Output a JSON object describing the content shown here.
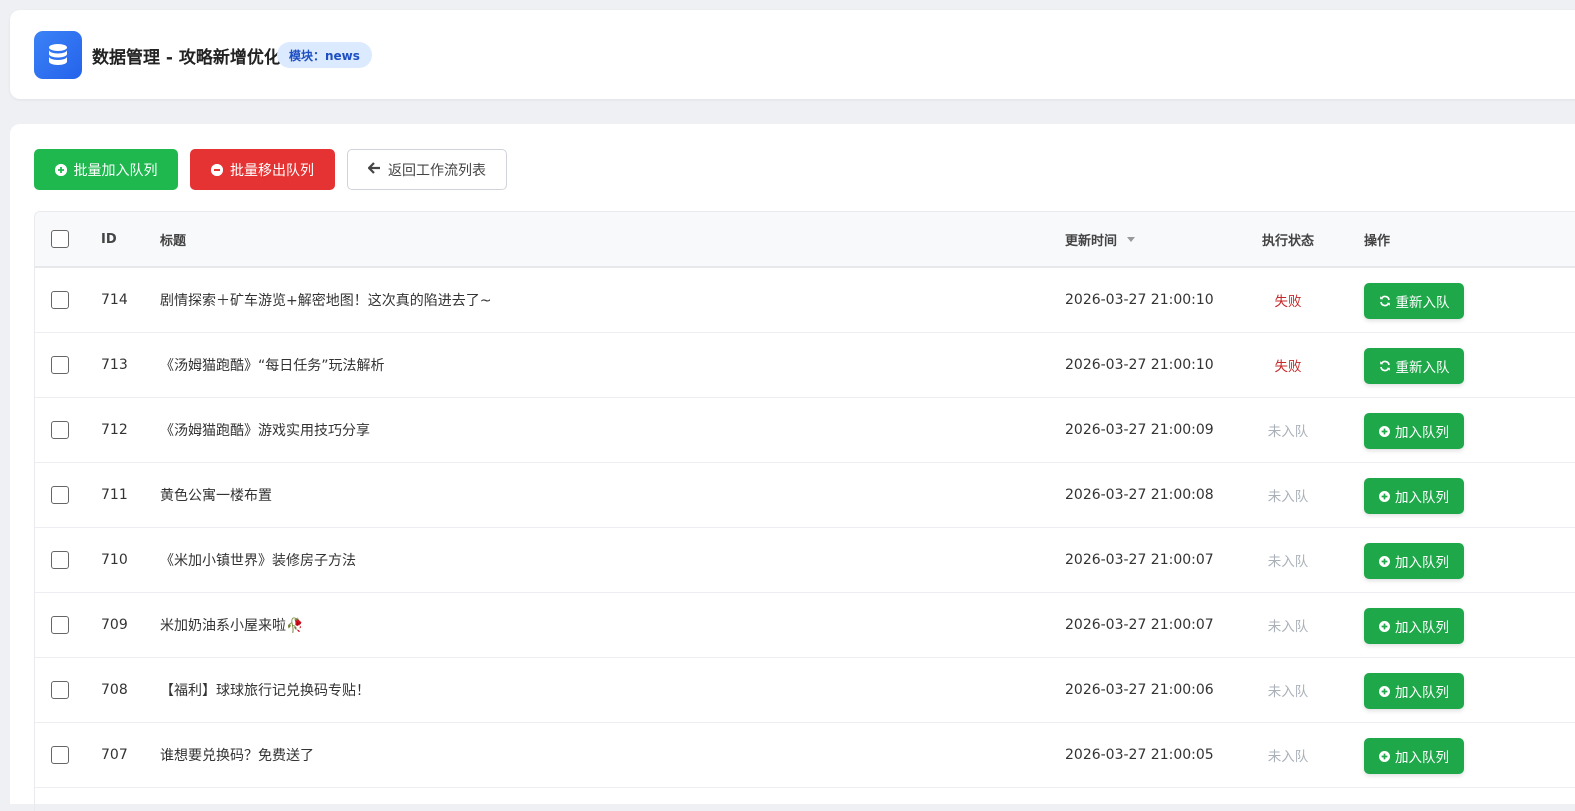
{
  "header": {
    "title": "数据管理 - 攻略新增优化",
    "module_badge": "模块：news"
  },
  "toolbar": {
    "batch_add_label": "批量加入队列",
    "batch_remove_label": "批量移出队列",
    "back_label": "返回工作流列表"
  },
  "table": {
    "columns": {
      "id": "ID",
      "title": "标题",
      "updated": "更新时间",
      "status": "执行状态",
      "action": "操作"
    },
    "rows": [
      {
        "id": "714",
        "title": "剧情探索＋矿车游览+解密地图！这次真的陷进去了~",
        "updated": "2026-03-27 21:00:10",
        "status": "失败",
        "status_type": "fail",
        "action": "重新入队",
        "action_icon": "refresh-icon"
      },
      {
        "id": "713",
        "title": "《汤姆猫跑酷》“每日任务”玩法解析",
        "updated": "2026-03-27 21:00:10",
        "status": "失败",
        "status_type": "fail",
        "action": "重新入队",
        "action_icon": "refresh-icon"
      },
      {
        "id": "712",
        "title": "《汤姆猫跑酷》游戏实用技巧分享",
        "updated": "2026-03-27 21:00:09",
        "status": "未入队",
        "status_type": "none",
        "action": "加入队列",
        "action_icon": "plus-circle-icon"
      },
      {
        "id": "711",
        "title": "黄色公寓一楼布置",
        "updated": "2026-03-27 21:00:08",
        "status": "未入队",
        "status_type": "none",
        "action": "加入队列",
        "action_icon": "plus-circle-icon"
      },
      {
        "id": "710",
        "title": "《米加小镇世界》装修房子方法",
        "updated": "2026-03-27 21:00:07",
        "status": "未入队",
        "status_type": "none",
        "action": "加入队列",
        "action_icon": "plus-circle-icon"
      },
      {
        "id": "709",
        "title": "米加奶油系小屋来啦🥀",
        "updated": "2026-03-27 21:00:07",
        "status": "未入队",
        "status_type": "none",
        "action": "加入队列",
        "action_icon": "plus-circle-icon"
      },
      {
        "id": "708",
        "title": "【福利】球球旅行记兑换码专贴！",
        "updated": "2026-03-27 21:00:06",
        "status": "未入队",
        "status_type": "none",
        "action": "加入队列",
        "action_icon": "plus-circle-icon"
      },
      {
        "id": "707",
        "title": "谁想要兑换码？免费送了",
        "updated": "2026-03-27 21:00:05",
        "status": "未入队",
        "status_type": "none",
        "action": "加入队列",
        "action_icon": "plus-circle-icon"
      }
    ]
  },
  "colors": {
    "primary_green": "#1fb84f",
    "danger_red": "#e53333",
    "accent_blue": "#2563eb",
    "fail_text": "#c62828",
    "muted_text": "#aab0b8"
  }
}
